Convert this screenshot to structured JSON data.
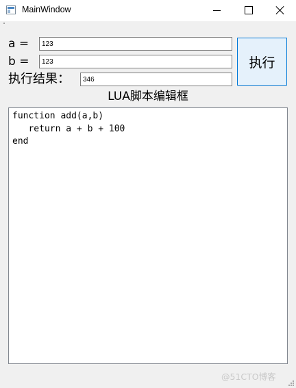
{
  "window": {
    "title": "MainWindow"
  },
  "form": {
    "a_label": "a =",
    "a_value": "123",
    "b_label": "b =",
    "b_value": "123",
    "result_label": "执行结果：",
    "result_value": "346",
    "execute_button": "执行"
  },
  "editor": {
    "title": "LUA脚本编辑框",
    "lines": [
      "function add(a,b)",
      "   return a + b + 100",
      "end"
    ]
  },
  "watermark": "@51CTO博客",
  "icons": {
    "app": "window-app-icon",
    "minimize": "minimize-icon",
    "maximize": "maximize-icon",
    "close": "close-icon",
    "resize": "resize-grip-icon"
  },
  "colors": {
    "button_face": "#e5f1fb",
    "button_border": "#0078d7",
    "window_bg": "#f0f0f0"
  }
}
